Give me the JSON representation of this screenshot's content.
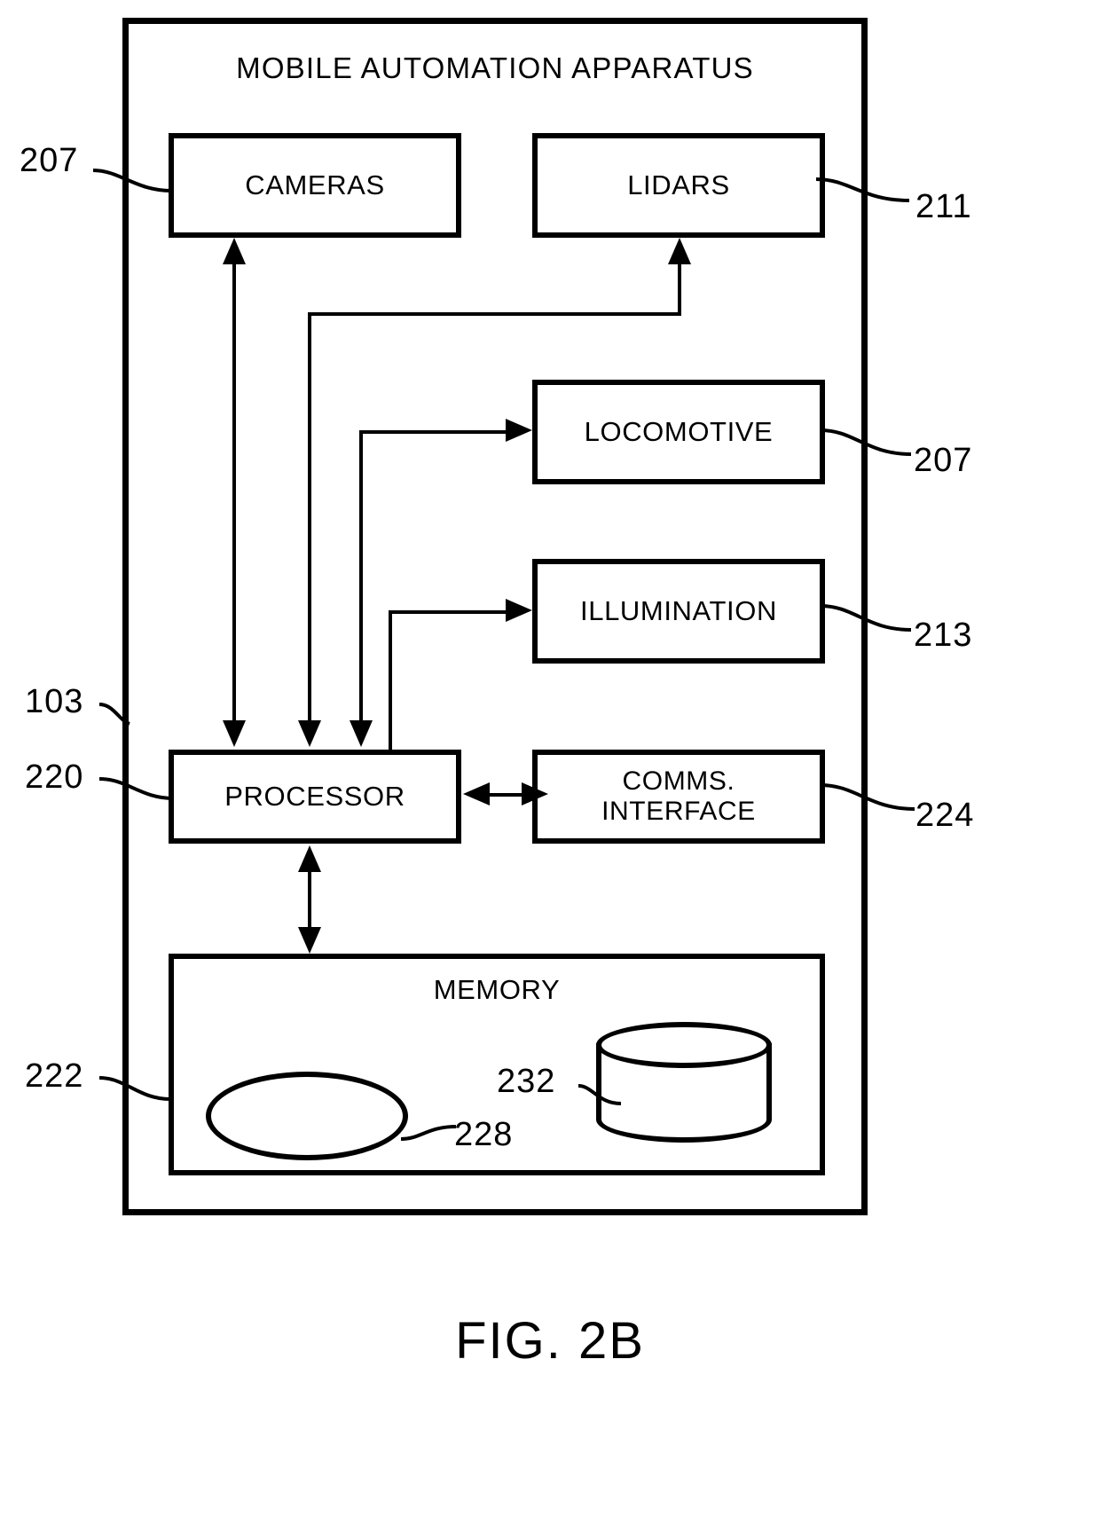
{
  "figure": {
    "caption": "FIG. 2B",
    "title": "MOBILE AUTOMATION APPARATUS"
  },
  "blocks": {
    "cameras": "CAMERAS",
    "lidars": "LIDARS",
    "locomotive": "LOCOMOTIVE",
    "illumination": "ILLUMINATION",
    "processor": "PROCESSOR",
    "comms_line1": "COMMS.",
    "comms_line2": "INTERFACE",
    "memory": "MEMORY"
  },
  "reference_numerals": {
    "cameras": "207",
    "lidars": "211",
    "locomotive": "207",
    "illumination": "213",
    "apparatus": "103",
    "processor": "220",
    "comms_interface": "224",
    "memory": "222",
    "oval_element": "228",
    "cylinder_element": "232"
  },
  "colors": {
    "stroke": "#000000",
    "background": "#ffffff"
  }
}
